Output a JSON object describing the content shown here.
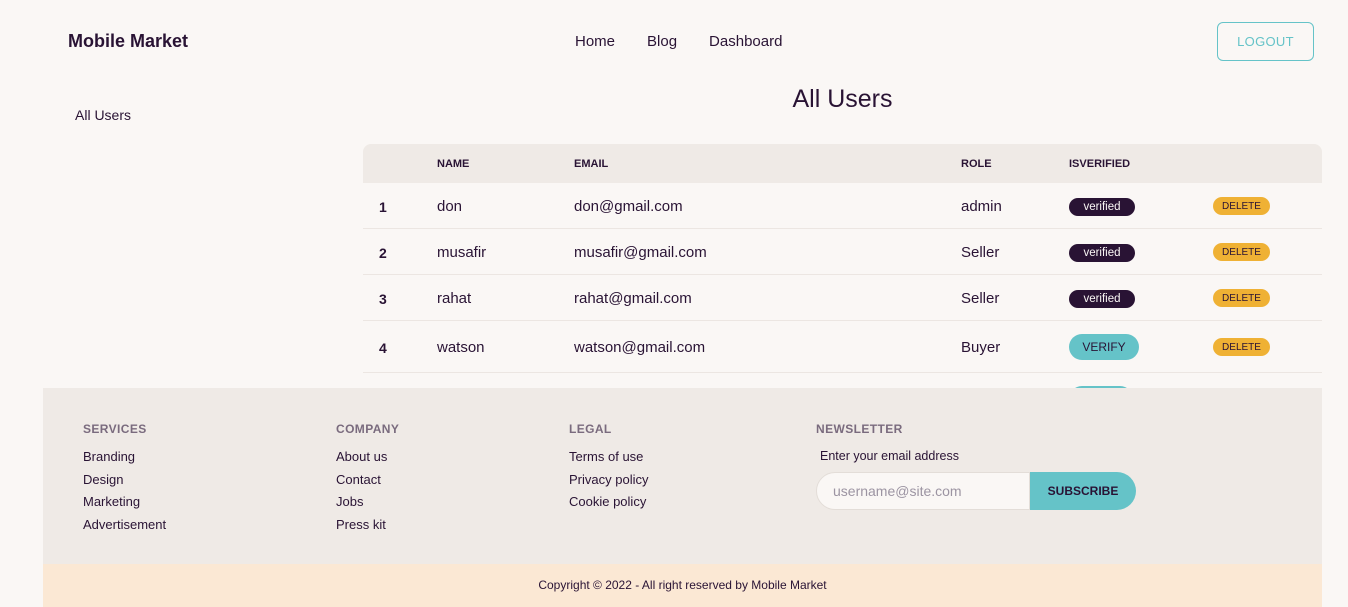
{
  "header": {
    "brand": "Mobile Market",
    "nav": [
      "Home",
      "Blog",
      "Dashboard"
    ],
    "logout_label": "LOGOUT"
  },
  "sidebar": {
    "items": [
      "All Users"
    ]
  },
  "main": {
    "title": "All Users",
    "table": {
      "columns": [
        "",
        "NAME",
        "EMAIL",
        "ROLE",
        "ISVERIFIED",
        ""
      ],
      "rows": [
        {
          "index": "1",
          "name": "don",
          "email": "don@gmail.com",
          "role": "admin",
          "status": "verified",
          "delete_label": "DELETE"
        },
        {
          "index": "2",
          "name": "musafir",
          "email": "musafir@gmail.com",
          "role": "Seller",
          "status": "verified",
          "delete_label": "DELETE"
        },
        {
          "index": "3",
          "name": "rahat",
          "email": "rahat@gmail.com",
          "role": "Seller",
          "status": "verified",
          "delete_label": "DELETE"
        },
        {
          "index": "4",
          "name": "watson",
          "email": "watson@gmail.com",
          "role": "Buyer",
          "status": "VERIFY",
          "delete_label": "DELETE"
        }
      ]
    }
  },
  "footer": {
    "services": {
      "title": "SERVICES",
      "links": [
        "Branding",
        "Design",
        "Marketing",
        "Advertisement"
      ]
    },
    "company": {
      "title": "COMPANY",
      "links": [
        "About us",
        "Contact",
        "Jobs",
        "Press kit"
      ]
    },
    "legal": {
      "title": "LEGAL",
      "links": [
        "Terms of use",
        "Privacy policy",
        "Cookie policy"
      ]
    },
    "newsletter": {
      "title": "NEWSLETTER",
      "label": "Enter your email address",
      "placeholder": "username@site.com",
      "button": "SUBSCRIBE"
    },
    "copyright": "Copyright © 2022 - All right reserved by Mobile Market"
  },
  "colors": {
    "primary": "#65c3c8",
    "dark": "#291334",
    "warning": "#efb134",
    "base": "#faf7f5"
  }
}
